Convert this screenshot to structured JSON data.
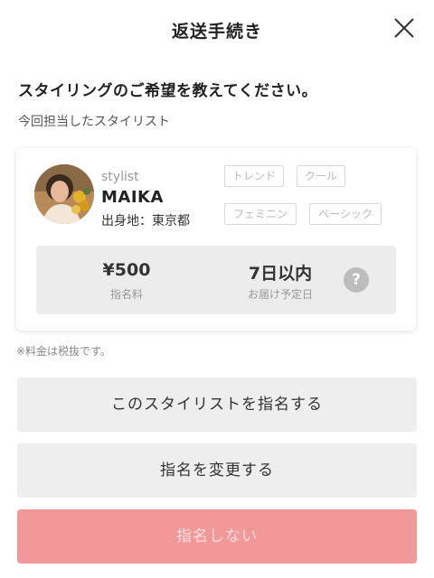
{
  "header": {
    "title": "返送手続き"
  },
  "heading": "スタイリングのご希望を教えてください。",
  "subheading": "今回担当したスタイリスト",
  "stylist": {
    "role": "stylist",
    "name": "MAIKA",
    "birthplace": "出身地：東京都",
    "tags": [
      "トレンド",
      "クール",
      "フェミニン",
      "ベーシック"
    ],
    "fee_value": "¥500",
    "fee_label": "指名料",
    "delivery_value": "7日以内",
    "delivery_label": "お届け予定日",
    "help_symbol": "?"
  },
  "note": "※料金は税抜です。",
  "buttons": {
    "nominate": "このスタイリストを指名する",
    "change": "指名を変更する",
    "decline": "指名しない"
  },
  "colors": {
    "decline_button": "#f39898",
    "neutral_button": "#eeeeee",
    "info_box": "#ececec"
  },
  "icons": {
    "close": "close-icon",
    "help": "help-icon"
  }
}
